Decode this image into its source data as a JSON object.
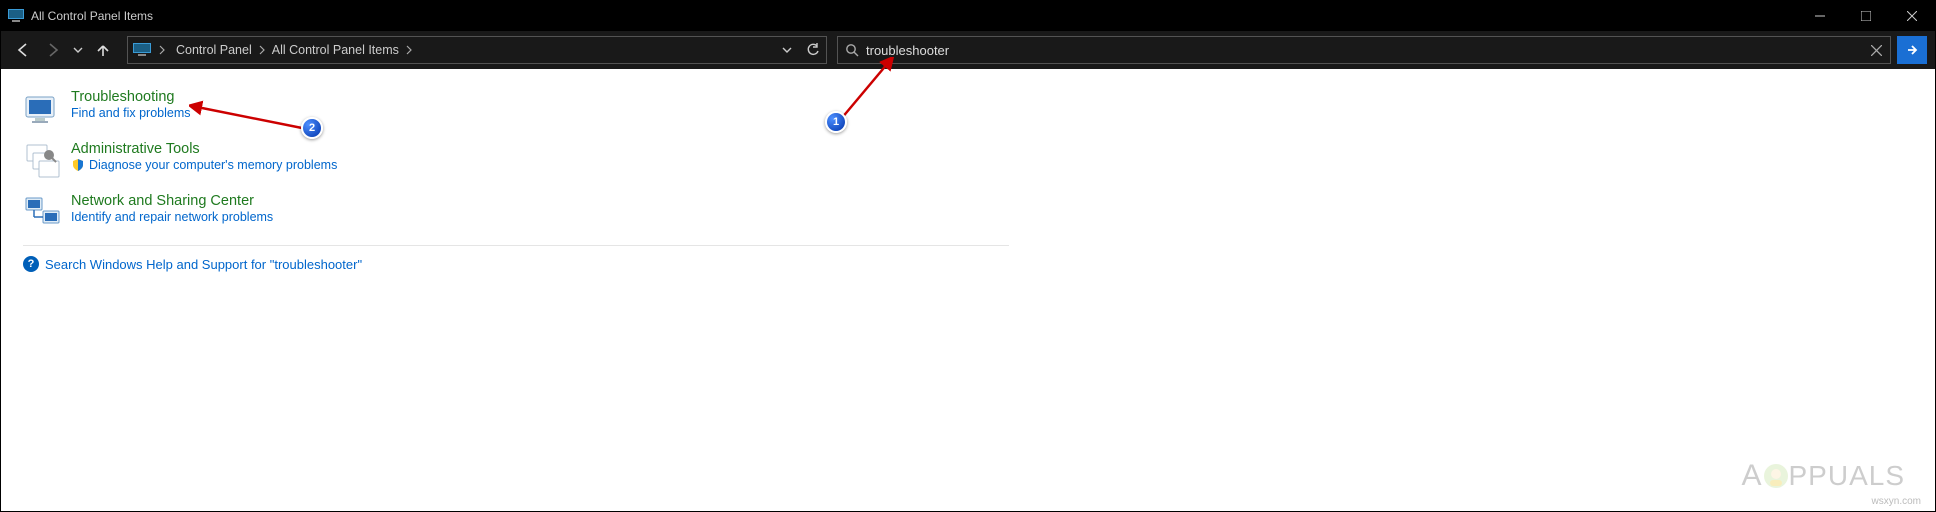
{
  "window": {
    "title": "All Control Panel Items"
  },
  "breadcrumb": {
    "root": "Control Panel",
    "current": "All Control Panel Items"
  },
  "search": {
    "value": "troubleshooter"
  },
  "results": {
    "troubleshooting": {
      "title": "Troubleshooting",
      "sub": "Find and fix problems"
    },
    "admin_tools": {
      "title": "Administrative Tools",
      "sub": "Diagnose your computer's memory problems"
    },
    "network": {
      "title": "Network and Sharing Center",
      "sub": "Identify and repair network problems"
    }
  },
  "help_link": "Search Windows Help and Support for \"troubleshooter\"",
  "badges": {
    "one": "1",
    "two": "2"
  },
  "logo_text": "PPUALS",
  "watermark": "wsxyn.com"
}
